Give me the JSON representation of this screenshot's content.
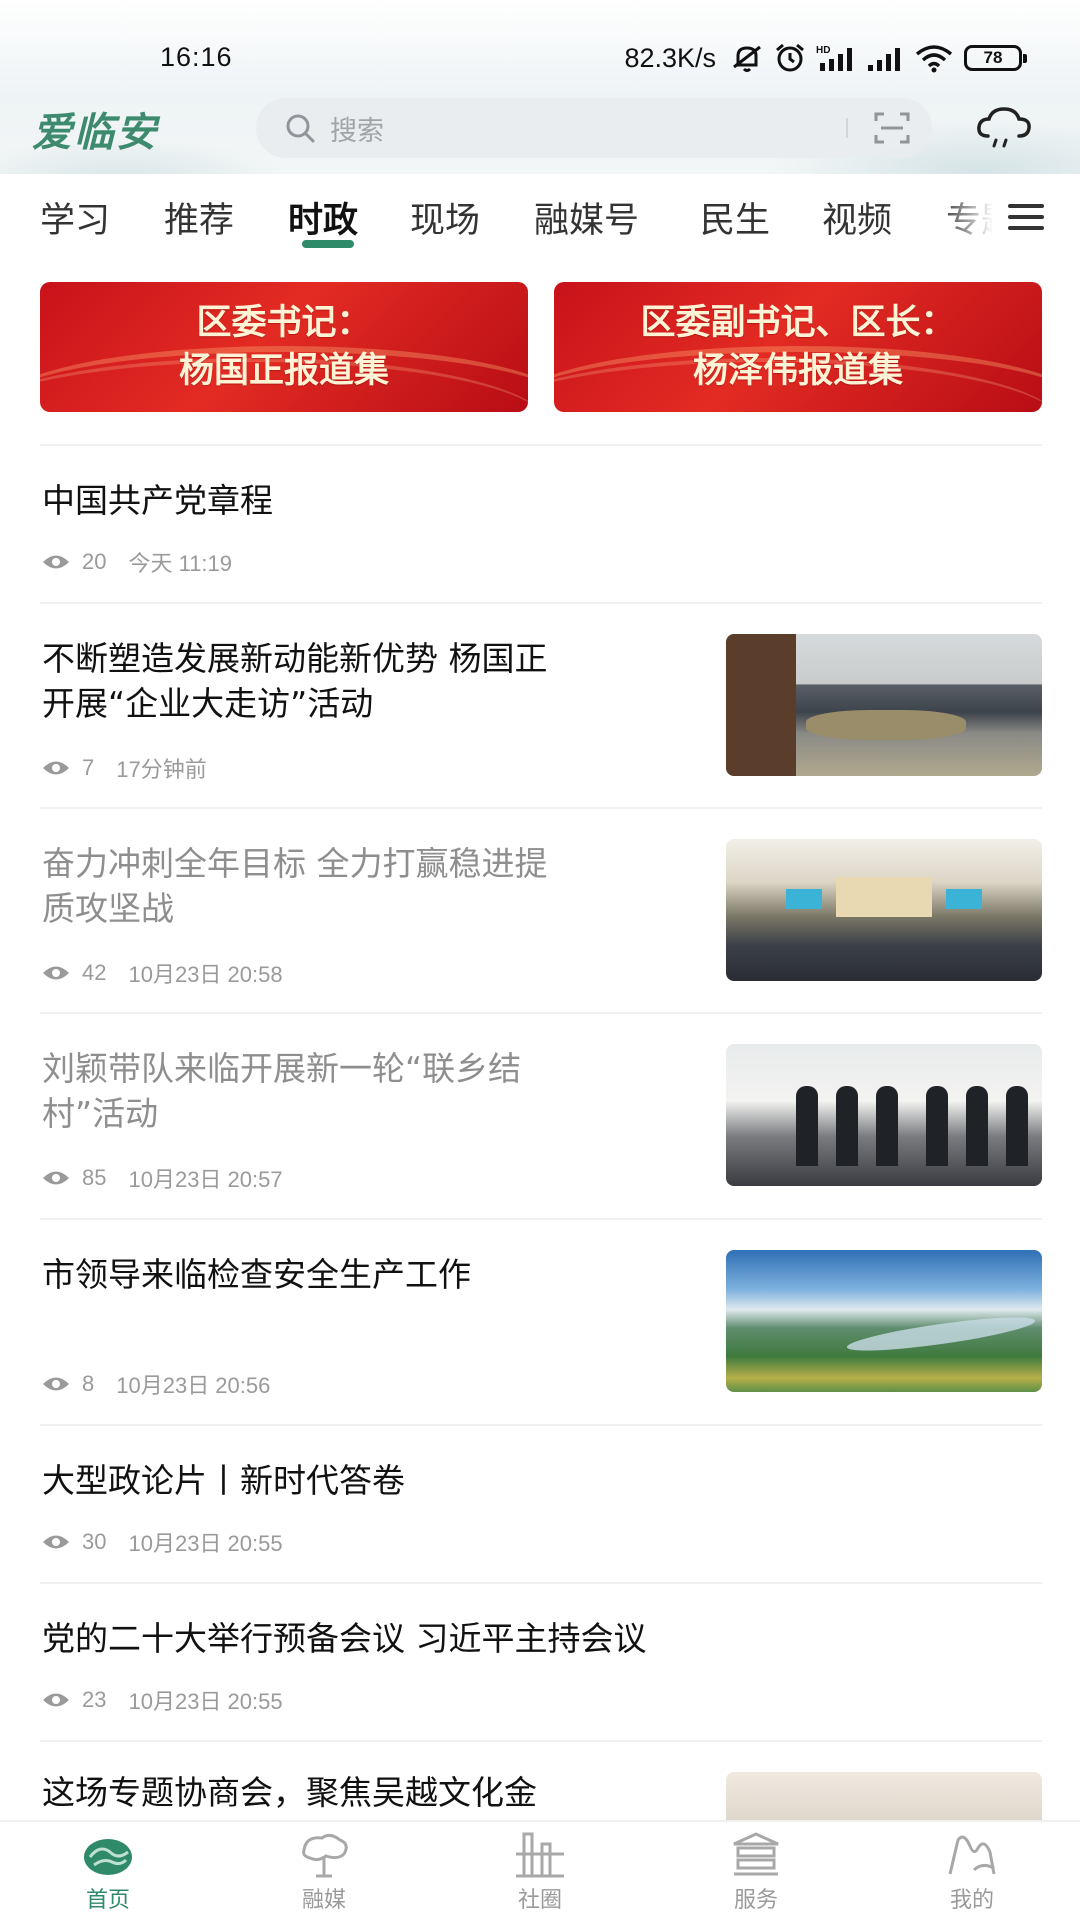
{
  "status_bar": {
    "time": "16:16",
    "network_speed": "82.3K/s",
    "battery": "78",
    "icons": [
      "mute-icon",
      "alarm-icon",
      "hd-signal-icon",
      "signal-icon",
      "wifi-icon",
      "battery-icon"
    ]
  },
  "header": {
    "logo": "爱临安",
    "search_placeholder": "搜索",
    "right_icon": "cloud-icon"
  },
  "tabs": [
    {
      "label": "学习"
    },
    {
      "label": "推荐"
    },
    {
      "label": "时政",
      "active": true
    },
    {
      "label": "现场"
    },
    {
      "label": "融媒号"
    },
    {
      "label": "民生"
    },
    {
      "label": "视频"
    },
    {
      "label": "专题"
    }
  ],
  "banners": [
    {
      "line1": "区委书记：",
      "line2": "杨国正报道集"
    },
    {
      "line1": "区委副书记、区长：",
      "line2": "杨泽伟报道集"
    }
  ],
  "news": [
    {
      "title": "中国共产党章程",
      "views": "20",
      "time": "今天 11:19"
    },
    {
      "title_line1": "不断塑造发展新动能新优势 杨国正",
      "title_line2": "开展“企业大走访”活动",
      "views": "7",
      "time": "17分钟前"
    },
    {
      "title_line1": "奋力冲刺全年目标 全力打赢稳进提",
      "title_line2": "质攻坚战",
      "views": "42",
      "time": "10月23日 20:58"
    },
    {
      "title_line1": "刘颖带队来临开展新一轮“联乡结",
      "title_line2": "村”活动",
      "views": "85",
      "time": "10月23日 20:57"
    },
    {
      "title": "市领导来临检查安全生产工作",
      "views": "8",
      "time": "10月23日 20:56"
    },
    {
      "title": "大型政论片丨新时代答卷",
      "views": "30",
      "time": "10月23日 20:55"
    },
    {
      "title": "党的二十大举行预备会议 习近平主持会议",
      "views": "23",
      "time": "10月23日 20:55"
    },
    {
      "title": "这场专题协商会，聚焦吴越文化金"
    }
  ],
  "bottom_nav": [
    {
      "label": "首页",
      "icon": "home-icon",
      "active": true
    },
    {
      "label": "融媒",
      "icon": "media-icon"
    },
    {
      "label": "社圈",
      "icon": "community-icon"
    },
    {
      "label": "服务",
      "icon": "service-icon"
    },
    {
      "label": "我的",
      "icon": "profile-icon"
    }
  ],
  "colors": {
    "accent": "#2f8a6a",
    "banner_red": "#d91e1e",
    "read_title": "#8e8e8e"
  }
}
